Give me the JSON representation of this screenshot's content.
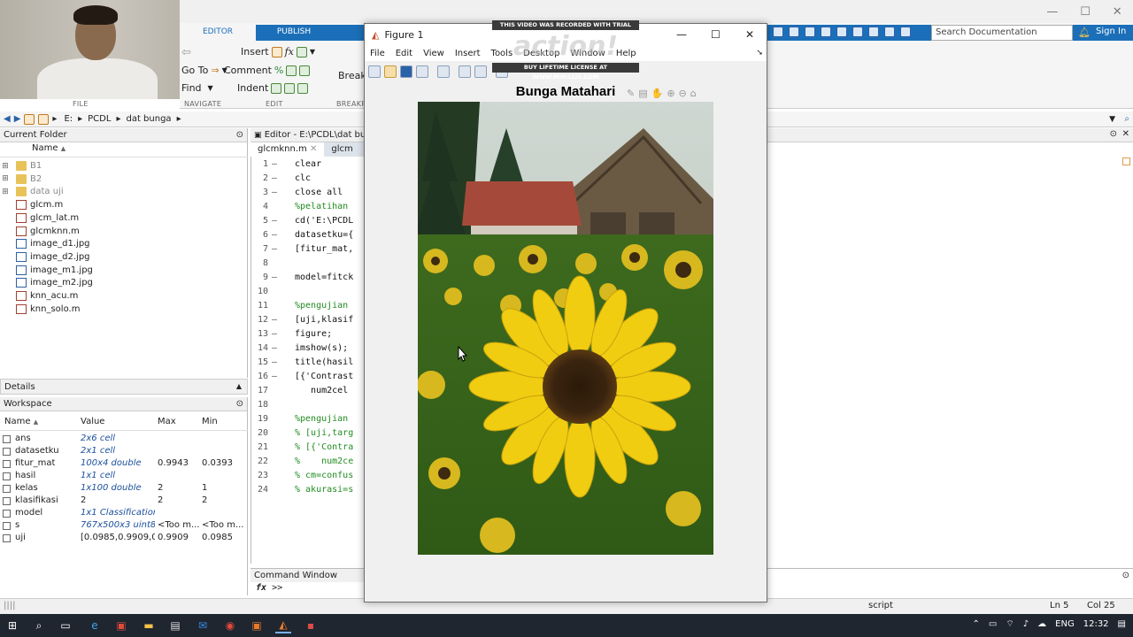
{
  "ribbon": {
    "tabs": [
      "EDITOR",
      "PUBLISH"
    ],
    "nav": {
      "go_to": "Go To",
      "find": "Find",
      "label": "NAVIGATE"
    },
    "edit": {
      "insert": "Insert",
      "comment": "Comment",
      "indent": "Indent",
      "label": "EDIT"
    },
    "file_label": "FILE",
    "breakpoints_label": "BREAKP",
    "breakpoints_btn": "Breakp",
    "search_placeholder": "Search Documentation",
    "sign_in": "Sign In"
  },
  "address": {
    "crumbs": [
      "E:",
      "PCDL",
      "dat bunga"
    ]
  },
  "current_folder": {
    "title": "Current Folder",
    "column": "Name",
    "sort_arrow": "▲",
    "items": [
      {
        "name": "B1",
        "type": "folder",
        "expandable": true
      },
      {
        "name": "B2",
        "type": "folder",
        "expandable": true
      },
      {
        "name": "data uji",
        "type": "folder",
        "expandable": true
      },
      {
        "name": "glcm.m",
        "type": "m"
      },
      {
        "name": "glcm_lat.m",
        "type": "m"
      },
      {
        "name": "glcmknn.m",
        "type": "m"
      },
      {
        "name": "image_d1.jpg",
        "type": "img"
      },
      {
        "name": "image_d2.jpg",
        "type": "img"
      },
      {
        "name": "image_m1.jpg",
        "type": "img"
      },
      {
        "name": "image_m2.jpg",
        "type": "img"
      },
      {
        "name": "knn_acu.m",
        "type": "m"
      },
      {
        "name": "knn_solo.m",
        "type": "m"
      }
    ]
  },
  "details": {
    "title": "Details"
  },
  "workspace": {
    "title": "Workspace",
    "columns": {
      "name": "Name",
      "value": "Value",
      "max": "Max",
      "min": "Min"
    },
    "sort_arrow": "▲",
    "rows": [
      {
        "name": "ans",
        "value": "2x6 cell",
        "max": "",
        "min": "",
        "plain": false
      },
      {
        "name": "datasetku",
        "value": "2x1 cell",
        "max": "",
        "min": "",
        "plain": false
      },
      {
        "name": "fitur_mat",
        "value": "100x4 double",
        "max": "0.9943",
        "min": "0.0393",
        "plain": false
      },
      {
        "name": "hasil",
        "value": "1x1 cell",
        "max": "",
        "min": "",
        "plain": false
      },
      {
        "name": "kelas",
        "value": "1x100 double",
        "max": "2",
        "min": "1",
        "plain": false
      },
      {
        "name": "klasifikasi",
        "value": "2",
        "max": "2",
        "min": "2",
        "plain": true
      },
      {
        "name": "model",
        "value": "1x1 Classification...",
        "max": "",
        "min": "",
        "plain": false
      },
      {
        "name": "s",
        "value": "767x500x3 uint8",
        "max": "<Too m...",
        "min": "<Too m...",
        "plain": false
      },
      {
        "name": "uji",
        "value": "[0.0985,0.9909,0....",
        "max": "0.9909",
        "min": "0.0985",
        "plain": true
      }
    ]
  },
  "editor": {
    "title": "Editor - E:\\PCDL\\dat bunga",
    "tabs": [
      "glcmknn.m",
      "glcm"
    ],
    "tab_close": "✕",
    "lines": [
      {
        "n": "1",
        "d": "–",
        "code": "clear",
        "cls": ""
      },
      {
        "n": "2",
        "d": "–",
        "code": "clc",
        "cls": ""
      },
      {
        "n": "3",
        "d": "–",
        "code": "close all",
        "cls": ""
      },
      {
        "n": "4",
        "d": "",
        "code": "%pelatihan",
        "cls": "cm"
      },
      {
        "n": "5",
        "d": "–",
        "code": "cd('E:\\PCDL",
        "cls": ""
      },
      {
        "n": "6",
        "d": "–",
        "code": "datasetku={",
        "cls": ""
      },
      {
        "n": "7",
        "d": "–",
        "code": "[fitur_mat,",
        "cls": ""
      },
      {
        "n": "8",
        "d": "",
        "code": "",
        "cls": ""
      },
      {
        "n": "9",
        "d": "–",
        "code": "model=fitck",
        "cls": ""
      },
      {
        "n": "10",
        "d": "",
        "code": "",
        "cls": ""
      },
      {
        "n": "11",
        "d": "",
        "code": "%pengujian",
        "cls": "cm"
      },
      {
        "n": "12",
        "d": "–",
        "code": "[uji,klasif",
        "cls": ""
      },
      {
        "n": "13",
        "d": "–",
        "code": "figure;",
        "cls": ""
      },
      {
        "n": "14",
        "d": "–",
        "code": "imshow(s);",
        "cls": ""
      },
      {
        "n": "15",
        "d": "–",
        "code": "title(hasil",
        "cls": ""
      },
      {
        "n": "16",
        "d": "–",
        "code": "[{'Contrast",
        "cls": ""
      },
      {
        "n": "17",
        "d": "",
        "code": "   num2cel",
        "cls": ""
      },
      {
        "n": "18",
        "d": "",
        "code": "",
        "cls": ""
      },
      {
        "n": "19",
        "d": "",
        "code": "%pengujian",
        "cls": "cm"
      },
      {
        "n": "20",
        "d": "",
        "code": "% [uji,targ",
        "cls": "cm"
      },
      {
        "n": "21",
        "d": "",
        "code": "% [{'Contra",
        "cls": "cm"
      },
      {
        "n": "22",
        "d": "",
        "code": "%    num2ce",
        "cls": "cm"
      },
      {
        "n": "23",
        "d": "",
        "code": "% cm=confus",
        "cls": "cm"
      },
      {
        "n": "24",
        "d": "",
        "code": "% akurasi=s",
        "cls": "cm"
      }
    ]
  },
  "command_window": {
    "title": "Command Window",
    "fx": "fx",
    "prompt": ">>"
  },
  "status": {
    "mode": "script",
    "ln": "Ln 5",
    "col": "Col 25"
  },
  "figure": {
    "window_title": "Figure 1",
    "menu": [
      "File",
      "Edit",
      "View",
      "Insert",
      "Tools",
      "Desktop",
      "Window",
      "Help"
    ],
    "plot_title": "Bunga Matahari"
  },
  "watermark": {
    "top": "THIS VIDEO WAS RECORDED WITH TRIAL VERSION",
    "bottom": "BUY LIFETIME LICENSE AT WWW.MIRILLIS.COM"
  },
  "taskbar": {
    "lang": "ENG",
    "time": "12:32"
  }
}
